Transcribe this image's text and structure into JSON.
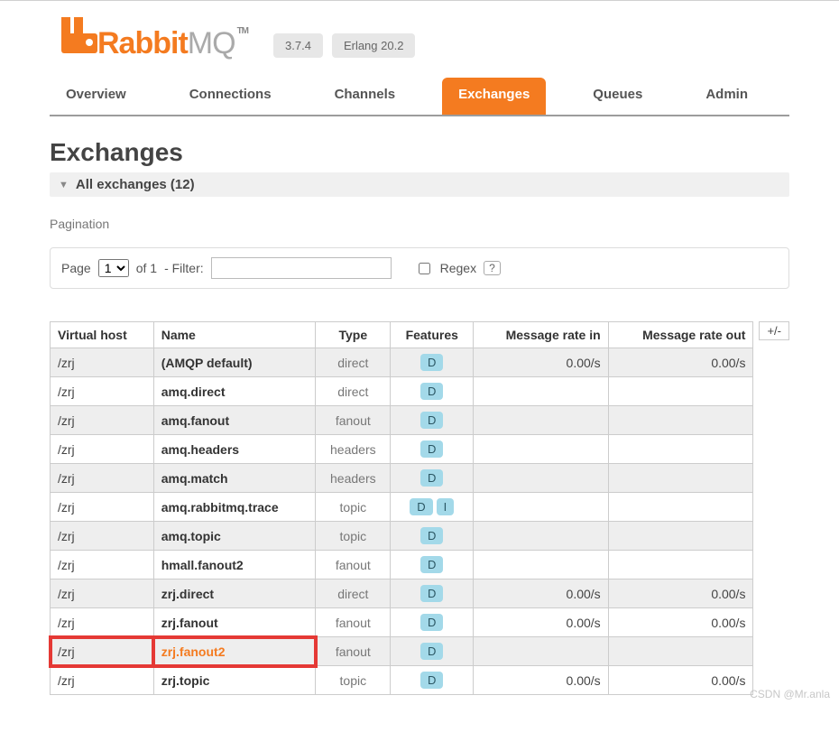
{
  "header": {
    "brand_a": "Rabbit",
    "brand_b": "MQ",
    "tm": "TM",
    "version": "3.7.4",
    "erlang": "Erlang 20.2"
  },
  "tabs": [
    {
      "label": "Overview",
      "active": false
    },
    {
      "label": "Connections",
      "active": false
    },
    {
      "label": "Channels",
      "active": false
    },
    {
      "label": "Exchanges",
      "active": true
    },
    {
      "label": "Queues",
      "active": false
    },
    {
      "label": "Admin",
      "active": false
    }
  ],
  "page_title": "Exchanges",
  "section": {
    "label": "All exchanges (12)"
  },
  "pagination": {
    "heading": "Pagination",
    "page_label": "Page",
    "page_value": "1",
    "of_label": "of 1",
    "filter_label": "- Filter:",
    "filter_value": "",
    "regex_label": "Regex",
    "help": "?"
  },
  "table": {
    "headers": {
      "vhost": "Virtual host",
      "name": "Name",
      "type": "Type",
      "features": "Features",
      "rate_in": "Message rate in",
      "rate_out": "Message rate out",
      "plusminus": "+/-"
    },
    "rows": [
      {
        "vhost": "/zrj",
        "name": "(AMQP default)",
        "type": "direct",
        "features": [
          "D"
        ],
        "rate_in": "0.00/s",
        "rate_out": "0.00/s",
        "highlight": false
      },
      {
        "vhost": "/zrj",
        "name": "amq.direct",
        "type": "direct",
        "features": [
          "D"
        ],
        "rate_in": "",
        "rate_out": "",
        "highlight": false
      },
      {
        "vhost": "/zrj",
        "name": "amq.fanout",
        "type": "fanout",
        "features": [
          "D"
        ],
        "rate_in": "",
        "rate_out": "",
        "highlight": false
      },
      {
        "vhost": "/zrj",
        "name": "amq.headers",
        "type": "headers",
        "features": [
          "D"
        ],
        "rate_in": "",
        "rate_out": "",
        "highlight": false
      },
      {
        "vhost": "/zrj",
        "name": "amq.match",
        "type": "headers",
        "features": [
          "D"
        ],
        "rate_in": "",
        "rate_out": "",
        "highlight": false
      },
      {
        "vhost": "/zrj",
        "name": "amq.rabbitmq.trace",
        "type": "topic",
        "features": [
          "D",
          "I"
        ],
        "rate_in": "",
        "rate_out": "",
        "highlight": false
      },
      {
        "vhost": "/zrj",
        "name": "amq.topic",
        "type": "topic",
        "features": [
          "D"
        ],
        "rate_in": "",
        "rate_out": "",
        "highlight": false
      },
      {
        "vhost": "/zrj",
        "name": "hmall.fanout2",
        "type": "fanout",
        "features": [
          "D"
        ],
        "rate_in": "",
        "rate_out": "",
        "highlight": false
      },
      {
        "vhost": "/zrj",
        "name": "zrj.direct",
        "type": "direct",
        "features": [
          "D"
        ],
        "rate_in": "0.00/s",
        "rate_out": "0.00/s",
        "highlight": false
      },
      {
        "vhost": "/zrj",
        "name": "zrj.fanout",
        "type": "fanout",
        "features": [
          "D"
        ],
        "rate_in": "0.00/s",
        "rate_out": "0.00/s",
        "highlight": false
      },
      {
        "vhost": "/zrj",
        "name": "zrj.fanout2",
        "type": "fanout",
        "features": [
          "D"
        ],
        "rate_in": "",
        "rate_out": "",
        "highlight": true
      },
      {
        "vhost": "/zrj",
        "name": "zrj.topic",
        "type": "topic",
        "features": [
          "D"
        ],
        "rate_in": "0.00/s",
        "rate_out": "0.00/s",
        "highlight": false
      }
    ]
  },
  "watermark": "CSDN @Mr.anla"
}
